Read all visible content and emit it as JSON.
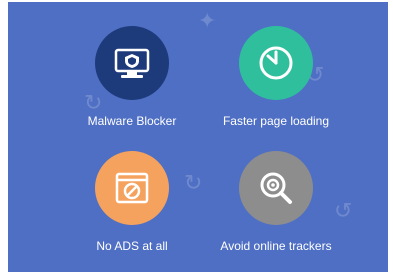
{
  "features": [
    {
      "label": "Malware Blocker",
      "icon": "monitor-shield-icon",
      "color": "#1d3a7a"
    },
    {
      "label": "Faster page loading",
      "icon": "clock-icon",
      "color": "#2fbf9c"
    },
    {
      "label": "No ADS at all",
      "icon": "no-ads-icon",
      "color": "#f5a25e"
    },
    {
      "label": "Avoid online trackers",
      "icon": "magnifier-icon",
      "color": "#8d8d8d"
    }
  ],
  "colors": {
    "background": "#4f6fc4",
    "text": "#ffffff"
  }
}
